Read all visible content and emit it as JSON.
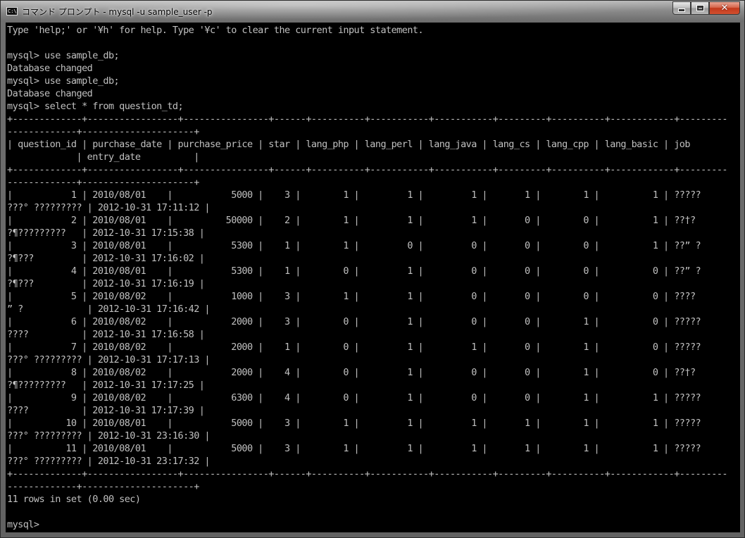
{
  "window": {
    "title": "コマンド プロンプト - mysql  -u sample_user -p",
    "icon": "C:\\",
    "controls": {
      "minimize": "minimize-icon",
      "maximize": "maximize-icon",
      "close": "close-icon"
    }
  },
  "console": {
    "lines": [
      "Type 'help;' or '¥h' for help. Type '¥c' to clear the current input statement.",
      "",
      "mysql> use sample_db;",
      "Database changed",
      "mysql> use sample_db;",
      "Database changed",
      "mysql> select * from question_td;",
      "+-------------+-----------------+----------------+------+----------+-----------+-----------+---------+----------+------------+---------",
      "-------------+---------------------+",
      "| question_id | purchase_date | purchase_price | star | lang_php | lang_perl | lang_java | lang_cs | lang_cpp | lang_basic | job",
      "             | entry_date          |",
      "+-------------+-----------------+----------------+------+----------+-----------+-----------+---------+----------+------------+---------",
      "-------------+---------------------+",
      "|           1 | 2010/08/01    |           5000 |    3 |        1 |         1 |         1 |       1 |        1 |          1 | ?????",
      "???° ????????? | 2012-10-31 17:11:12 |",
      "|           2 | 2010/08/01    |          50000 |    2 |        1 |         1 |         1 |       0 |        0 |          1 | ??†?",
      "?¶?????????   | 2012-10-31 17:15:38 |",
      "|           3 | 2010/08/01    |           5300 |    1 |        1 |         0 |         0 |       0 |        0 |          1 | ??” ?",
      "?¶???         | 2012-10-31 17:16:02 |",
      "|           4 | 2010/08/01    |           5300 |    1 |        0 |         1 |         0 |       0 |        0 |          0 | ??” ?",
      "?¶???         | 2012-10-31 17:16:19 |",
      "|           5 | 2010/08/02    |           1000 |    3 |        1 |         1 |         0 |       0 |        0 |          0 | ????",
      "” ?            | 2012-10-31 17:16:42 |",
      "|           6 | 2010/08/02    |           2000 |    3 |        0 |         1 |         0 |       0 |        1 |          0 | ?????",
      "????          | 2012-10-31 17:16:58 |",
      "|           7 | 2010/08/02    |           2000 |    1 |        0 |         1 |         1 |       0 |        1 |          0 | ?????",
      "???° ????????? | 2012-10-31 17:17:13 |",
      "|           8 | 2010/08/02    |           2000 |    4 |        0 |         1 |         0 |       0 |        1 |          0 | ??†?",
      "?¶?????????   | 2012-10-31 17:17:25 |",
      "|           9 | 2010/08/02    |           6300 |    4 |        0 |         1 |         0 |       0 |        1 |          1 | ?????",
      "????          | 2012-10-31 17:17:39 |",
      "|          10 | 2010/08/01    |           5000 |    3 |        1 |         1 |         1 |       1 |        1 |          1 | ?????",
      "???° ????????? | 2012-10-31 23:16:30 |",
      "|          11 | 2010/08/01    |           5000 |    3 |        1 |         1 |         1 |       1 |        1 |          1 | ?????",
      "???° ????????? | 2012-10-31 23:17:32 |",
      "+-------------+-----------------+----------------+------+----------+-----------+-----------+---------+----------+------------+---------",
      "-------------+---------------------+",
      "11 rows in set (0.00 sec)",
      "",
      "mysql>"
    ]
  }
}
